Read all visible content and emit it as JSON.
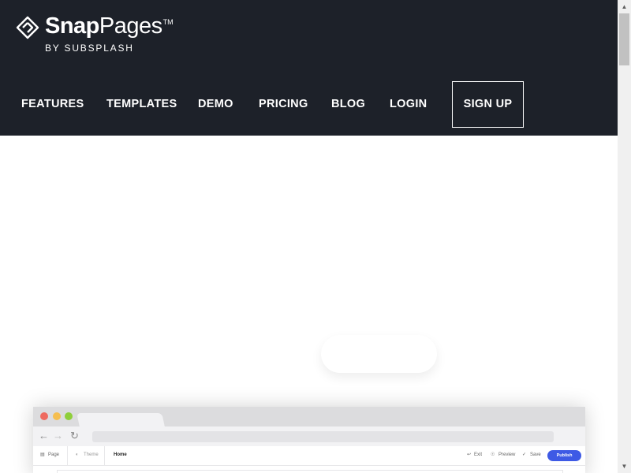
{
  "brand": {
    "name_bold": "Snap",
    "name_light": "Pages",
    "trademark": "TM",
    "tagline": "BY SUBSPLASH"
  },
  "nav": {
    "items": [
      "FEATURES",
      "TEMPLATES",
      "DEMO",
      "PRICING",
      "BLOG",
      "LOGIN"
    ],
    "signup": "SIGN UP"
  },
  "mockup": {
    "traffic_lights": [
      "#ee6a5f",
      "#f5be4f",
      "#8fcf3b"
    ],
    "toolbar": {
      "page": "Page",
      "theme": "Theme",
      "current_page": "Home",
      "exit": "Exit",
      "preview": "Preview",
      "save": "Save",
      "publish": "Publish"
    }
  },
  "colors": {
    "header_bg": "#1d2129",
    "publish_blue": "#3e5ae5"
  }
}
